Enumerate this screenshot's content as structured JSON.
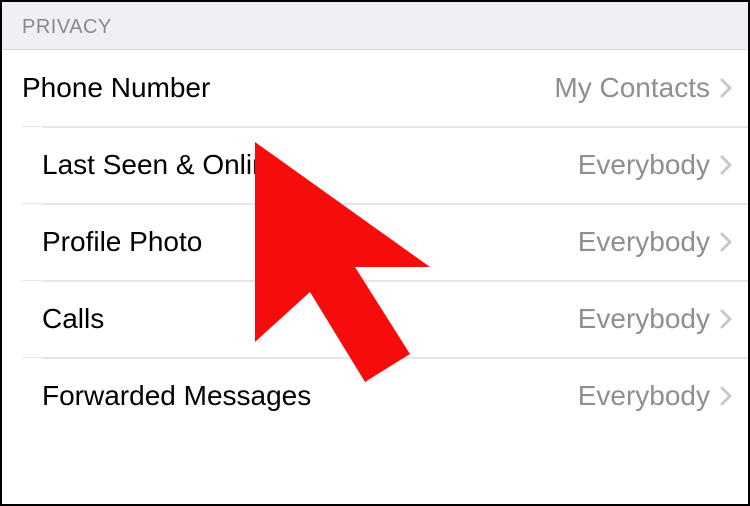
{
  "section": {
    "title": "PRIVACY"
  },
  "rows": [
    {
      "label": "Phone Number",
      "value": "My Contacts"
    },
    {
      "label": "Last Seen & Online",
      "value": "Everybody"
    },
    {
      "label": "Profile Photo",
      "value": "Everybody"
    },
    {
      "label": "Calls",
      "value": "Everybody"
    },
    {
      "label": "Forwarded Messages",
      "value": "Everybody"
    }
  ],
  "cursor": {
    "color": "#f70c0c"
  }
}
